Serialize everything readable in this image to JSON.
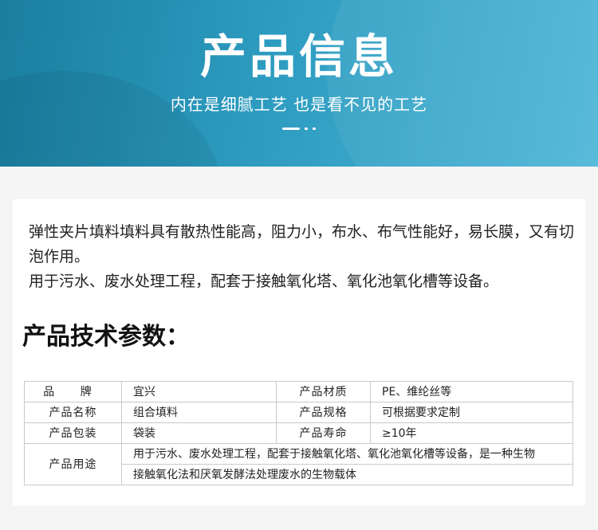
{
  "header": {
    "title": "产品信息",
    "subtitle": "内在是细腻工艺 也是看不见的工艺"
  },
  "description": {
    "paragraph1": "弹性夹片填料填料具有散热性能高，阻力小，布水、布气性能好，易长膜，又有切泡作用。",
    "paragraph2": "用于污水、废水处理工程，配套于接触氧化塔、氧化池氧化槽等设备。"
  },
  "params": {
    "title": "产品技术参数：",
    "rows": [
      {
        "label1": "品 牌",
        "value1": "宜兴",
        "label2": "产品材质",
        "value2": "PE、维纶丝等"
      },
      {
        "label1": "产品名称",
        "value1": "组合填料",
        "label2": "产品规格",
        "value2": "可根据要求定制"
      },
      {
        "label1": "产品包装",
        "value1": "袋装",
        "label2": "产品寿命",
        "value2": "≥10年"
      }
    ],
    "usage": {
      "label": "产品用途",
      "line1": "用于污水、废水处理工程，配套于接触氧化塔、氧化池氧化槽等设备，是一种生物",
      "line2": "接触氧化法和厌氧发酵法处理废水的生物载体"
    }
  },
  "colors": {
    "hero_start": "#1a7ea0",
    "hero_end": "#4fb6d8",
    "text": "#222222",
    "border": "#c9c9c9"
  }
}
